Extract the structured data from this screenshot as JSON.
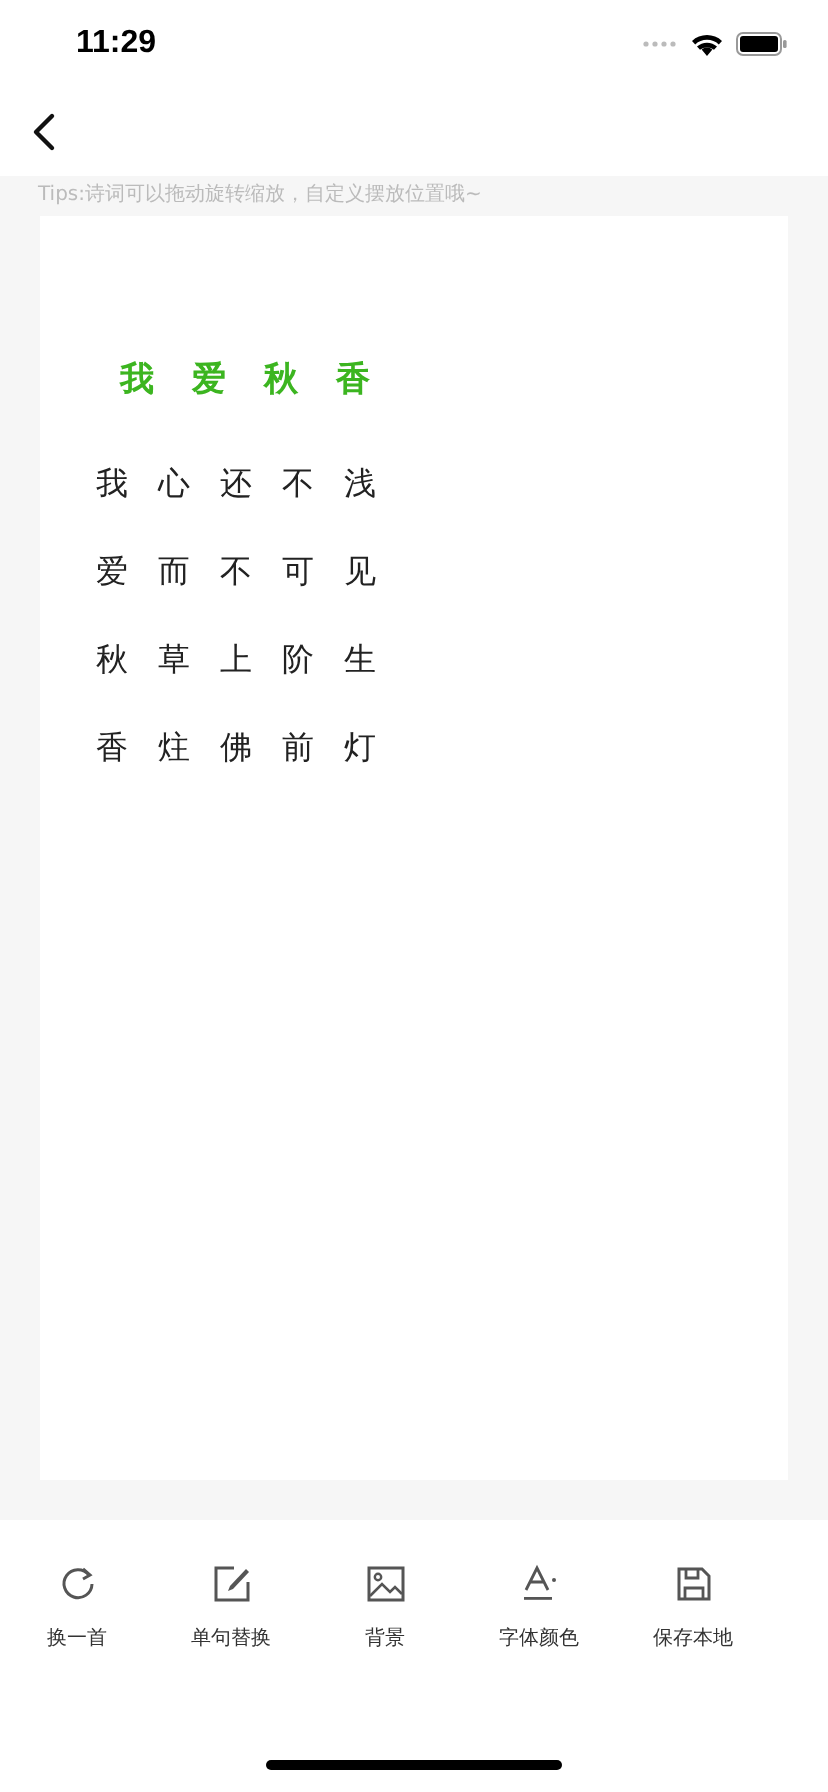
{
  "status_bar": {
    "time": "11:29"
  },
  "tips": "Tips:诗词可以拖动旋转缩放，自定义摆放位置哦~",
  "poem": {
    "title": "我爱秋香",
    "lines": [
      "我心还不浅",
      "爱而不可见",
      "秋草上阶生",
      "香炷佛前灯"
    ]
  },
  "toolbar": [
    {
      "kind": "refresh",
      "label": "换一首"
    },
    {
      "kind": "edit",
      "label": "单句替换"
    },
    {
      "kind": "image",
      "label": "背景"
    },
    {
      "kind": "font",
      "label": "字体颜色"
    },
    {
      "kind": "save",
      "label": "保存本地"
    }
  ]
}
